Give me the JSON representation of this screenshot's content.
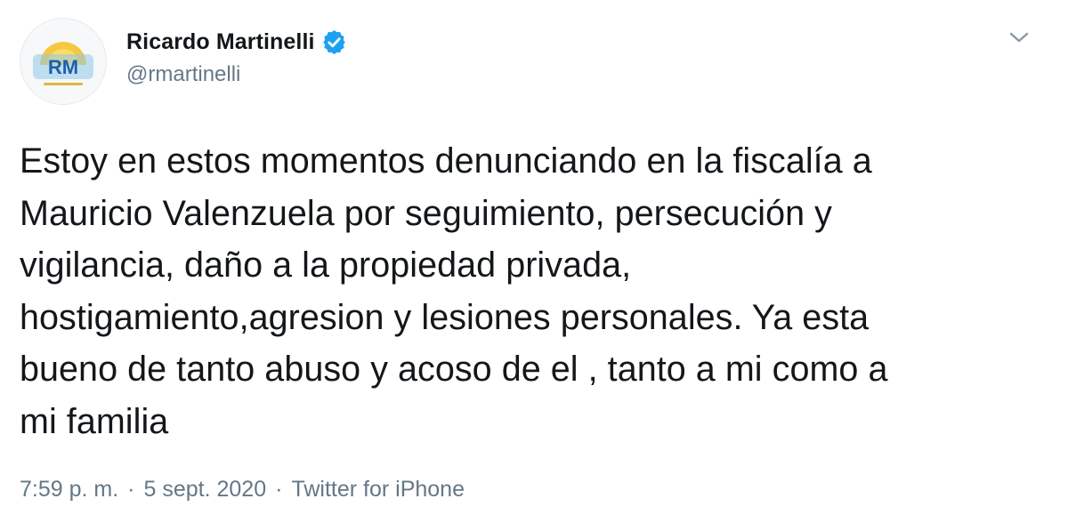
{
  "author": {
    "display_name": "Ricardo Martinelli",
    "handle": "@rmartinelli",
    "verified": true,
    "avatar_initials": "RM"
  },
  "tweet": {
    "text": "Estoy en estos momentos denunciando en la fiscalía a\nMauricio Valenzuela por seguimiento, persecución y\nvigilancia, daño a la propiedad privada,\nhostigamiento,agresion y lesiones personales. Ya esta\nbueno de tanto abuso y acoso de el , tanto a mi como a\nmi familia"
  },
  "meta": {
    "time": "7:59 p. m.",
    "separator": "·",
    "date": "5 sept. 2020",
    "source": "Twitter for iPhone"
  },
  "icons": {
    "verified": "verified-badge-icon",
    "menu": "chevron-down-icon"
  },
  "colors": {
    "verified_blue": "#1da1f2",
    "text_primary": "#14171a",
    "text_secondary": "#657786"
  }
}
